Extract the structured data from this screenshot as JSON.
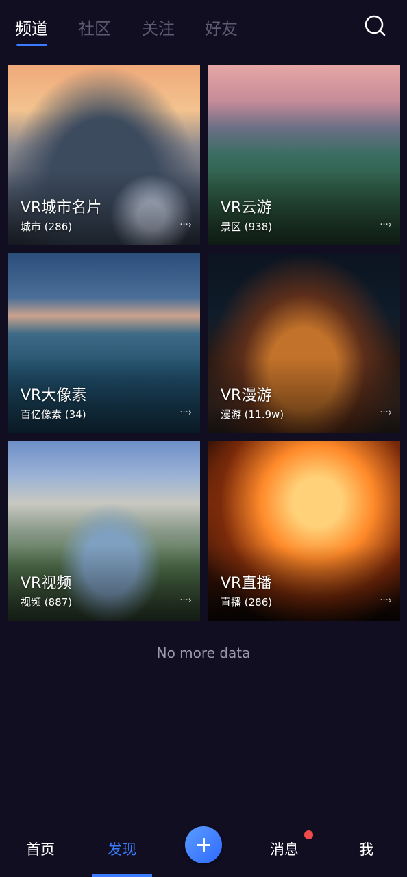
{
  "top_tabs": [
    {
      "label": "频道",
      "active": true
    },
    {
      "label": "社区",
      "active": false
    },
    {
      "label": "关注",
      "active": false
    },
    {
      "label": "好友",
      "active": false
    }
  ],
  "search": {
    "icon": "search-icon"
  },
  "cards": [
    {
      "title": "VR城市名片",
      "subtitle": "城市 (286)",
      "more": "···›"
    },
    {
      "title": "VR云游",
      "subtitle": "景区 (938)",
      "more": "···›"
    },
    {
      "title": "VR大像素",
      "subtitle": "百亿像素 (34)",
      "more": "···›"
    },
    {
      "title": "VR漫游",
      "subtitle": "漫游 (11.9w)",
      "more": "···›"
    },
    {
      "title": "VR视频",
      "subtitle": "视频 (887)",
      "more": "···›"
    },
    {
      "title": "VR直播",
      "subtitle": "直播 (286)",
      "more": "···›"
    }
  ],
  "status": {
    "no_more": "No more data"
  },
  "bottom_nav": {
    "home": "首页",
    "discover": "发现",
    "add_icon": "plus-icon",
    "messages": "消息",
    "me": "我",
    "active": "discover"
  },
  "colors": {
    "background": "#110e22",
    "accent": "#3a7bff",
    "inactive_tab": "#5e5b70",
    "badge": "#f04b4b"
  }
}
